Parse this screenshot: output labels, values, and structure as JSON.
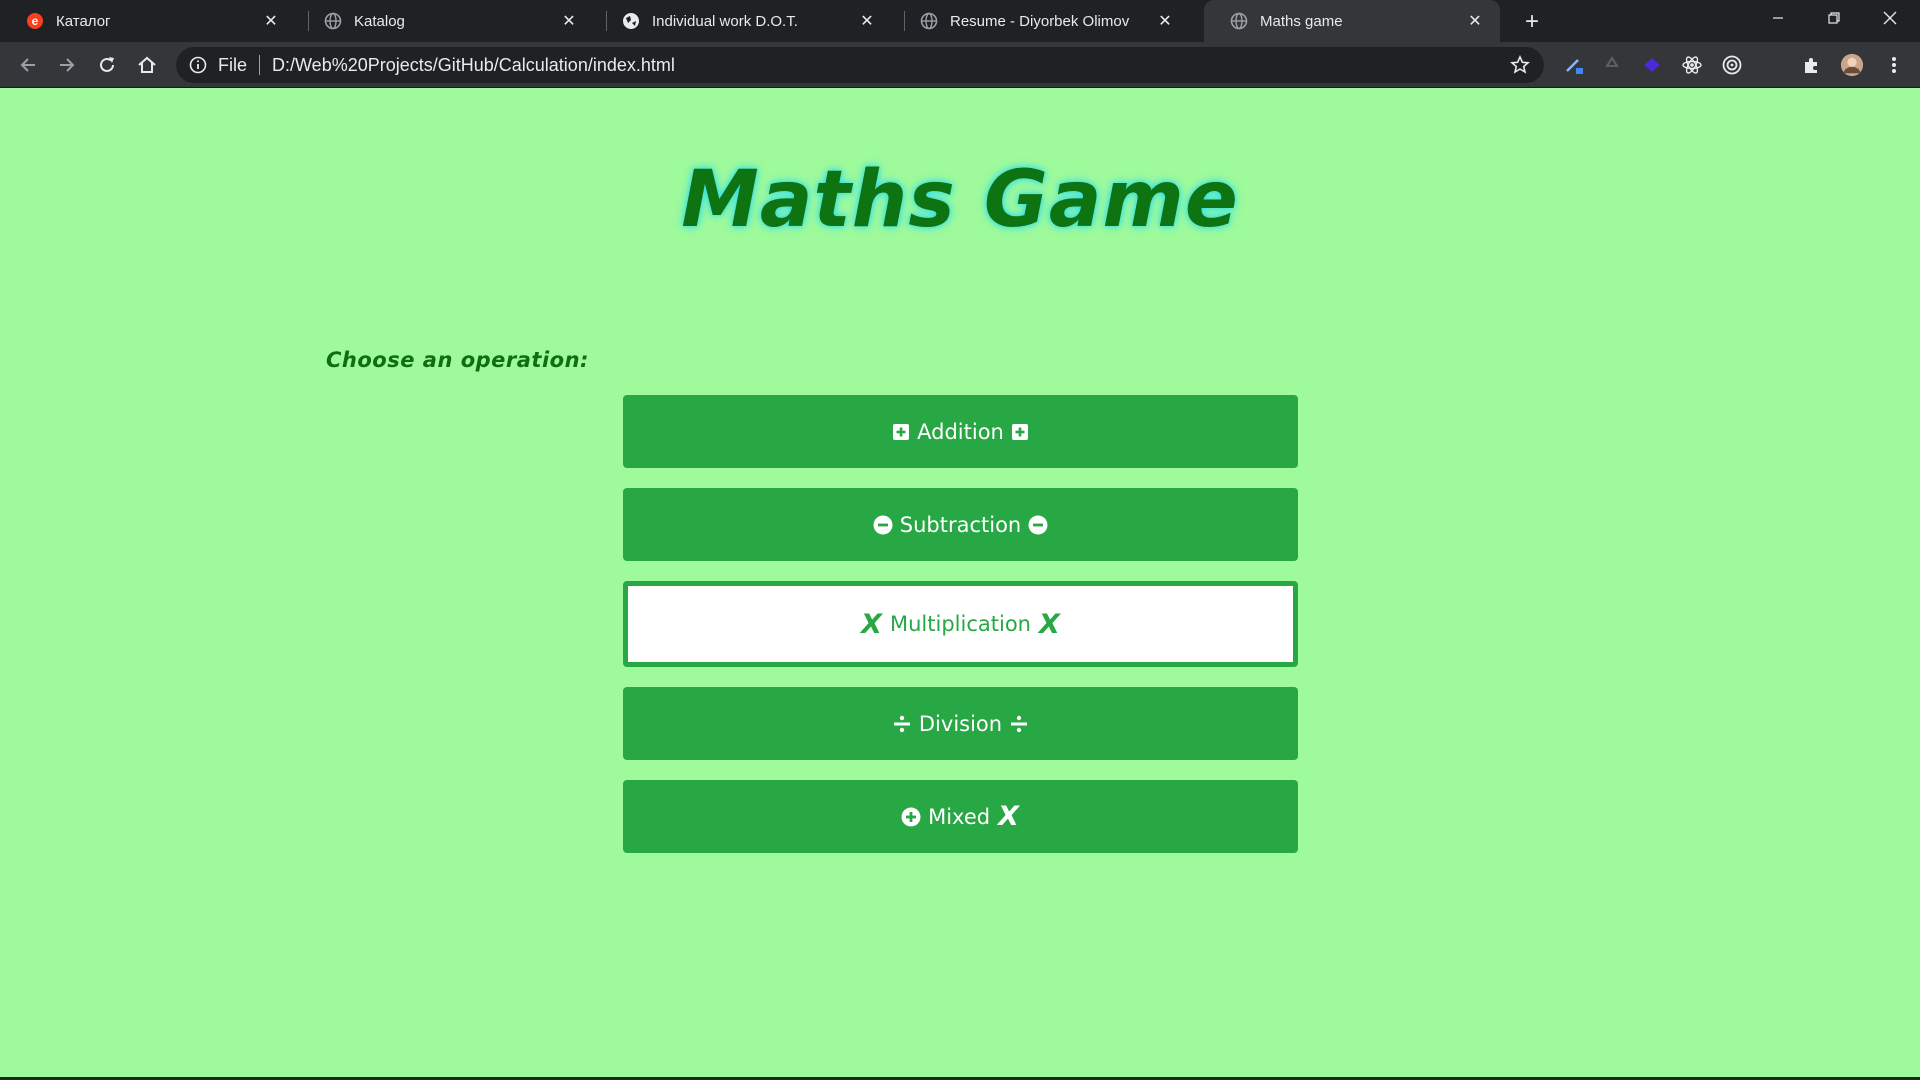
{
  "browser": {
    "tabs": [
      {
        "title": "Каталог",
        "favicon": "yandex-e-icon",
        "active": false
      },
      {
        "title": "Katalog",
        "favicon": "globe-icon",
        "active": false
      },
      {
        "title": "Individual work D.O.T.",
        "favicon": "globe-icon",
        "active": false
      },
      {
        "title": "Resume - Diyorbek Olimov",
        "favicon": "globe-icon",
        "active": false
      },
      {
        "title": "Maths game",
        "favicon": "globe-icon",
        "active": true
      }
    ],
    "address": {
      "scheme_label": "File",
      "url": "D:/Web%20Projects/GitHub/Calculation/index.html"
    }
  },
  "page": {
    "title": "Maths Game",
    "prompt": "Choose an operation:",
    "operations": [
      {
        "label": "Addition",
        "left_icon": "plus-square-icon",
        "right_icon": "plus-square-icon",
        "selected": false
      },
      {
        "label": "Subtraction",
        "left_icon": "minus-circle-icon",
        "right_icon": "minus-circle-icon",
        "selected": false
      },
      {
        "label": "Multiplication",
        "left_icon": "x-letter-icon",
        "right_icon": "x-letter-icon",
        "left_glyph": "X",
        "right_glyph": "X",
        "selected": true
      },
      {
        "label": "Division",
        "left_icon": "divide-icon",
        "right_icon": "divide-icon",
        "selected": false
      },
      {
        "label": "Mixed",
        "left_icon": "plus-circle-icon",
        "right_icon": "x-letter-icon",
        "right_glyph": "X",
        "selected": false
      }
    ]
  },
  "colors": {
    "page_background": "#9ffa9b",
    "button_green": "#28a745",
    "title_green": "#0e7411",
    "title_glow": "#36e0e6"
  }
}
